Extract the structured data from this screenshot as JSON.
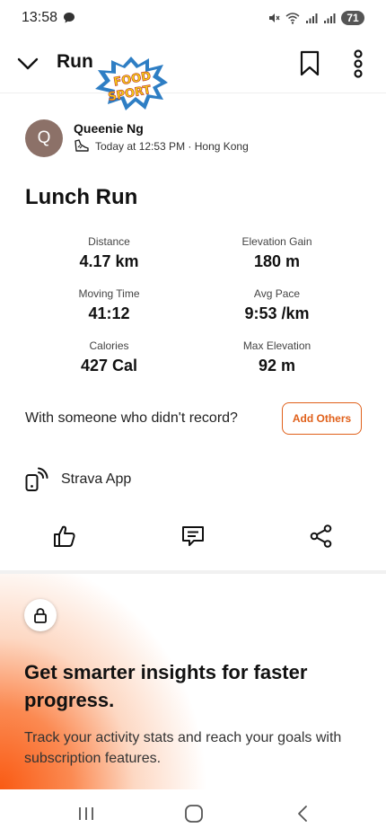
{
  "status_bar": {
    "time": "13:58",
    "battery": "71"
  },
  "header": {
    "title": "Run",
    "logo_text_top": "FOOD",
    "logo_text_bottom": "SPORT"
  },
  "athlete": {
    "initial": "Q",
    "name": "Queenie Ng",
    "meta": "Today at 12:53 PM · Hong Kong"
  },
  "activity": {
    "title": "Lunch Run"
  },
  "stats": [
    {
      "label": "Distance",
      "value": "4.17 km"
    },
    {
      "label": "Elevation Gain",
      "value": "180 m"
    },
    {
      "label": "Moving Time",
      "value": "41:12"
    },
    {
      "label": "Avg Pace",
      "value": "9:53 /km"
    },
    {
      "label": "Calories",
      "value": "427 Cal"
    },
    {
      "label": "Max Elevation",
      "value": "92 m"
    }
  ],
  "with_someone": {
    "text": "With someone who didn't record?",
    "button": "Add Others"
  },
  "device": {
    "label": "Strava App"
  },
  "promo": {
    "title": "Get smarter insights for faster progress.",
    "description": "Track your activity stats and reach your goals with subscription features."
  },
  "colors": {
    "accent": "#e0601a",
    "promo_gradient": "#f95a13"
  }
}
